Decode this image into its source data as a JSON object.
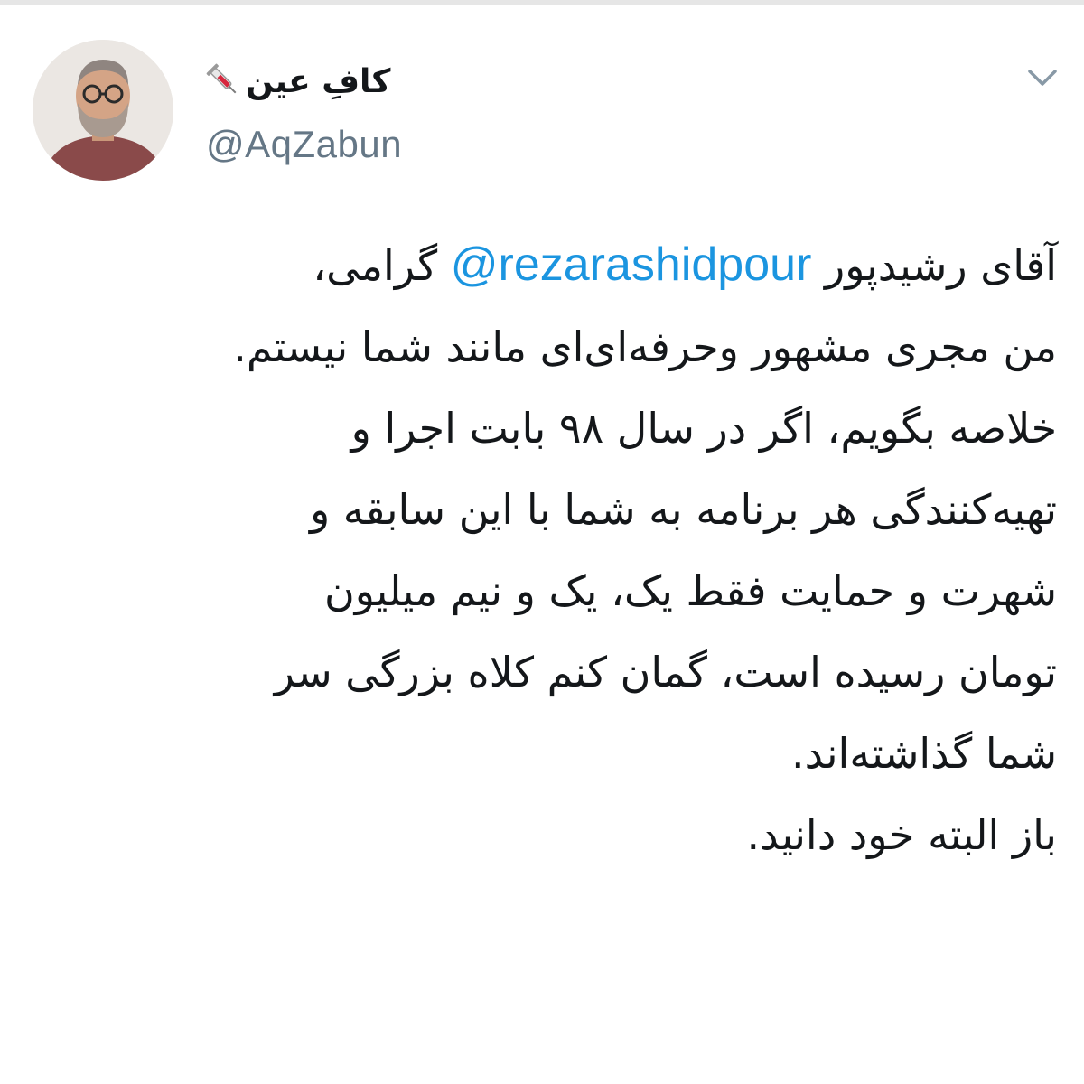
{
  "tweet": {
    "display_name": "کافِ عین",
    "name_emoji_icon": "syringe-icon",
    "handle": "@AqZabun",
    "menu_icon": "chevron-down-icon",
    "mention": "@rezarashidpour",
    "body_lines": {
      "l1_before": "آقای رشیدپور",
      "l1_after": "گرامی،",
      "l2": "من مجری مشهور وحرفه‌ای‌ای مانند شما نیستم.",
      "l3": "خلاصه بگویم، اگر در سال ۹۸ بابت اجرا و",
      "l4": "تهیه‌کنندگی هر برنامه به شما با این سابقه و",
      "l5": "شهرت و حمایت فقط یک، یک و نیم میلیون",
      "l6": "تومان رسیده است، گمان کنم کلاه بزرگی سر",
      "l7": "شما گذاشته‌اند.",
      "l8": "باز البته خود دانید."
    }
  },
  "colors": {
    "mention": "#1b95e0",
    "handle": "#657786",
    "text": "#14171a"
  }
}
